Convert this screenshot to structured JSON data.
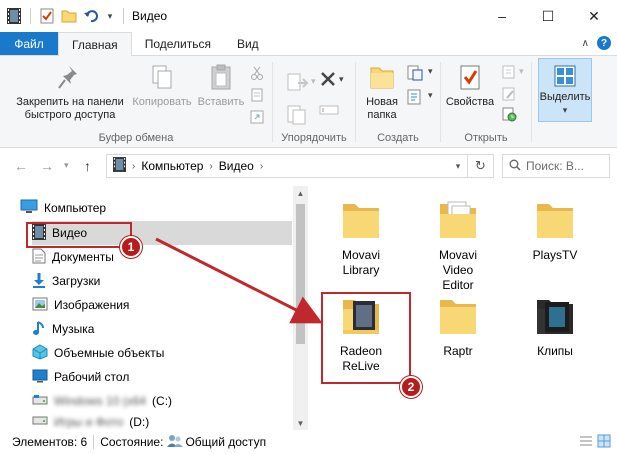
{
  "window": {
    "title": "Видео",
    "minimize_glyph": "–",
    "maximize_glyph": "☐",
    "close_glyph": "✕"
  },
  "tabs": {
    "file": "Файл",
    "home": "Главная",
    "share": "Поделиться",
    "view": "Вид"
  },
  "ribbon": {
    "clipboard": {
      "label": "Буфер обмена",
      "pin": "Закрепить на панели\nбыстрого доступа",
      "copy": "Копировать",
      "paste": "Вставить"
    },
    "organize": {
      "label": "Упорядочить"
    },
    "create": {
      "label": "Создать",
      "new_folder": "Новая\nпапка"
    },
    "open": {
      "label": "Открыть",
      "properties": "Свойства"
    },
    "select": {
      "label": "Выделить"
    }
  },
  "addressbar": {
    "crumbs": [
      "Компьютер",
      "Видео"
    ],
    "search_placeholder": "Поиск: В..."
  },
  "navpane": {
    "items": [
      {
        "label": "Компьютер",
        "icon": "computer-icon"
      },
      {
        "label": "Видео",
        "icon": "video-icon"
      },
      {
        "label": "Документы",
        "icon": "documents-icon"
      },
      {
        "label": "Загрузки",
        "icon": "downloads-icon"
      },
      {
        "label": "Изображения",
        "icon": "pictures-icon"
      },
      {
        "label": "Музыка",
        "icon": "music-icon"
      },
      {
        "label": "Объемные объекты",
        "icon": "3d-objects-icon"
      },
      {
        "label": "Рабочий стол",
        "icon": "desktop-icon"
      }
    ],
    "drive_c_suffix": "(C:)",
    "drive_d_suffix": "(D:)"
  },
  "content": {
    "items": [
      {
        "label": "Movavi\nLibrary",
        "type": "folder"
      },
      {
        "label": "Movavi\nVideo\nEditor",
        "type": "folder-docs"
      },
      {
        "label": "PlaysTV",
        "type": "folder"
      },
      {
        "label": "Radeon\nReLive",
        "type": "folder-video"
      },
      {
        "label": "Raptr",
        "type": "folder"
      },
      {
        "label": "Клипы",
        "type": "folder-video-dark"
      }
    ]
  },
  "status": {
    "count": "Элементов: 6",
    "state_label": "Состояние:",
    "state_value": "Общий доступ"
  },
  "annotations": {
    "badge1": "1",
    "badge2": "2",
    "color": "#c0282d"
  },
  "colors": {
    "accent": "#1979ca",
    "folder": "#f8d775",
    "folder_dark": "#e8b84a",
    "selection": "#d9d9d9"
  }
}
